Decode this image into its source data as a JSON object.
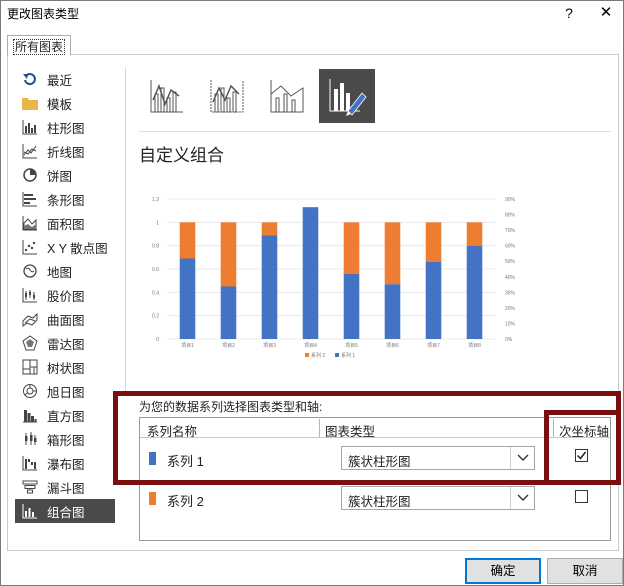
{
  "window": {
    "title": "更改图表类型",
    "help": "?",
    "close": "✕"
  },
  "tabs": [
    {
      "label": "所有图表"
    }
  ],
  "sidebar": {
    "items": [
      {
        "label": "最近",
        "icon": "recent-icon"
      },
      {
        "label": "模板",
        "icon": "folder-icon"
      },
      {
        "label": "柱形图",
        "icon": "column-chart-icon"
      },
      {
        "label": "折线图",
        "icon": "line-chart-icon"
      },
      {
        "label": "饼图",
        "icon": "pie-chart-icon"
      },
      {
        "label": "条形图",
        "icon": "bar-chart-icon"
      },
      {
        "label": "面积图",
        "icon": "area-chart-icon"
      },
      {
        "label": "X Y 散点图",
        "icon": "scatter-chart-icon"
      },
      {
        "label": "地图",
        "icon": "map-chart-icon"
      },
      {
        "label": "股价图",
        "icon": "stock-chart-icon"
      },
      {
        "label": "曲面图",
        "icon": "surface-chart-icon"
      },
      {
        "label": "雷达图",
        "icon": "radar-chart-icon"
      },
      {
        "label": "树状图",
        "icon": "treemap-chart-icon"
      },
      {
        "label": "旭日图",
        "icon": "sunburst-chart-icon"
      },
      {
        "label": "直方图",
        "icon": "histogram-chart-icon"
      },
      {
        "label": "箱形图",
        "icon": "box-whisker-chart-icon"
      },
      {
        "label": "瀑布图",
        "icon": "waterfall-chart-icon"
      },
      {
        "label": "漏斗图",
        "icon": "funnel-chart-icon"
      },
      {
        "label": "组合图",
        "icon": "combo-chart-icon",
        "active": true
      }
    ]
  },
  "combo_subtypes": [
    {
      "name": "clustered-column-line"
    },
    {
      "name": "clustered-column-line-secondary-axis"
    },
    {
      "name": "stacked-area-clustered-column"
    },
    {
      "name": "custom-combination",
      "selected": true
    }
  ],
  "main": {
    "heading": "自定义组合",
    "section_label": "为您的数据系列选择图表类型和轴:",
    "columns": {
      "series_name": "系列名称",
      "chart_type": "图表类型",
      "secondary_axis": "次坐标轴"
    },
    "series": [
      {
        "name": "系列 1",
        "color": "#4472c4",
        "chart_type": "簇状柱形图",
        "secondary_axis": true
      },
      {
        "name": "系列 2",
        "color": "#ed7d31",
        "chart_type": "簇状柱形图",
        "secondary_axis": false
      }
    ]
  },
  "buttons": {
    "ok": "确定",
    "cancel": "取消"
  },
  "colors": {
    "series1": "#4472c4",
    "series2": "#ed7d31",
    "highlight": "#7a0f0f",
    "active_bg": "#4a4a4a"
  },
  "chart_data": {
    "type": "bar",
    "stacked": true,
    "categories": [
      "项目1",
      "项目2",
      "项目3",
      "项目4",
      "项目5",
      "项目6",
      "项目7",
      "项目8"
    ],
    "series": [
      {
        "name": "系列 1",
        "axis": "primary",
        "values": [
          0.69,
          0.45,
          0.89,
          1.13,
          0.56,
          0.47,
          0.66,
          0.8
        ]
      },
      {
        "name": "系列 2",
        "axis": "primary",
        "values": [
          0.31,
          0.55,
          0.11,
          0,
          0.44,
          0.53,
          0.34,
          0.2
        ]
      }
    ],
    "legend": [
      "系列 2",
      "系列 1"
    ],
    "legend_position": "bottom",
    "y_ticks": [
      "0",
      "0.2",
      "0.4",
      "0.6",
      "0.8",
      "1",
      "1.2"
    ],
    "y2_ticks": [
      "0%",
      "10%",
      "20%",
      "30%",
      "40%",
      "50%",
      "60%",
      "70%",
      "80%",
      "90%"
    ],
    "ylim": [
      0,
      1.2
    ],
    "y2lim": [
      0,
      0.9
    ],
    "grid": true
  }
}
